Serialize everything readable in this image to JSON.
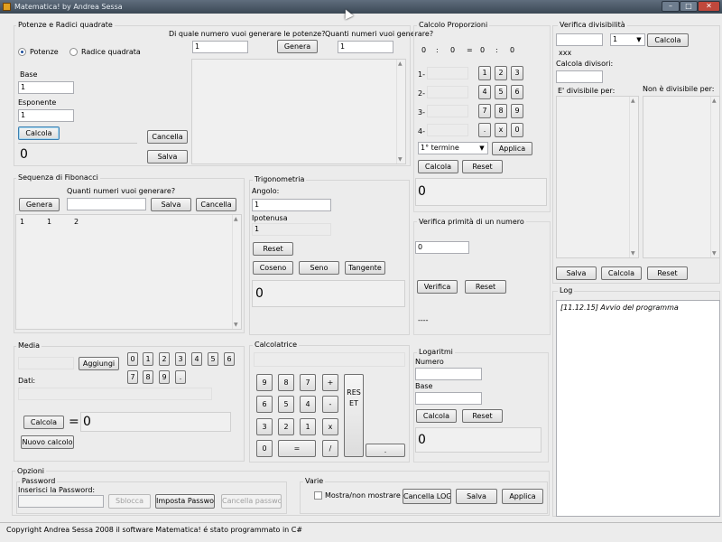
{
  "window": {
    "title": "Matematica! by Andrea Sessa",
    "minimize": "–",
    "maximize": "□",
    "close": "✕"
  },
  "potenze": {
    "title": "Potenze e Radici quadrate",
    "radio_potenze": "Potenze",
    "radio_radice": "Radice quadrata",
    "base_label": "Base",
    "base_value": "1",
    "esponente_label": "Esponente",
    "esponente_value": "1",
    "calcola": "Calcola",
    "result": "0",
    "cancella": "Cancella",
    "salva": "Salva",
    "from_label": "Di quale numero vuoi generare le potenze?",
    "from_value": "1",
    "genera": "Genera",
    "count_label": "Quanti numeri vuoi generare?",
    "count_value": "1"
  },
  "proporzioni": {
    "title": "Calcolo Proporzioni",
    "display": [
      "0",
      ":",
      "0",
      "=",
      "0",
      ":",
      "0"
    ],
    "rows": [
      "1-",
      "2-",
      "3-",
      "4-"
    ],
    "keypad": [
      [
        "1",
        "2",
        "3"
      ],
      [
        "4",
        "5",
        "6"
      ],
      [
        "7",
        "8",
        "9"
      ],
      [
        ".",
        "x",
        "0"
      ]
    ],
    "combo": "1° termine",
    "applica": "Applica",
    "calcola": "Calcola",
    "reset": "Reset",
    "result": "0"
  },
  "divisibilita": {
    "title": "Verifica divisibilità",
    "number_value": "",
    "combo": "1",
    "calcola": "Calcola",
    "xxx": "xxx",
    "divisori_label": "Calcola divisori:",
    "divisibile_label": "E' divisibile per:",
    "non_divisibile_label": "Non è divisibile per:",
    "salva": "Salva",
    "calcola2": "Calcola",
    "reset": "Reset"
  },
  "fibonacci": {
    "title": "Sequenza di Fibonacci",
    "count_label": "Quanti numeri vuoi generare?",
    "genera": "Genera",
    "salva": "Salva",
    "cancella": "Cancella",
    "values": [
      "1",
      "1",
      "2"
    ]
  },
  "trigonometria": {
    "title": "Trigonometria",
    "angolo_label": "Angolo:",
    "angolo_value": "1",
    "ipotenusa_label": "Ipotenusa",
    "ipotenusa_value": "1",
    "reset": "Reset",
    "coseno": "Coseno",
    "seno": "Seno",
    "tangente": "Tangente",
    "result": "0"
  },
  "primo": {
    "title": "Verifica primità di un numero",
    "value": "0",
    "verifica": "Verifica",
    "reset": "Reset",
    "result": "----"
  },
  "log": {
    "title": "Log",
    "entries": [
      "[11.12.15] Avvio del programma"
    ]
  },
  "media": {
    "title": "Media",
    "aggiungi": "Aggiungi",
    "keypad_row1": [
      "0",
      "1",
      "2",
      "3",
      "4",
      "5",
      "6"
    ],
    "keypad_row2": [
      "7",
      "8",
      "9",
      "."
    ],
    "dati_label": "Dati:",
    "calcola": "Calcola",
    "equals": "=",
    "result": "0",
    "nuovo": "Nuovo calcolo"
  },
  "calcolatrice": {
    "title": "Calcolatrice",
    "keys": [
      [
        "9",
        "8",
        "7",
        "+"
      ],
      [
        "6",
        "5",
        "4",
        "-"
      ],
      [
        "3",
        "2",
        "1",
        "x"
      ]
    ],
    "zero": "0",
    "equals": "=",
    "divide": "/",
    "reset": "RESET",
    "dot": "."
  },
  "logaritmi": {
    "title": "Logaritmi",
    "numero_label": "Numero",
    "base_label": "Base",
    "calcola": "Calcola",
    "reset": "Reset",
    "result": "0"
  },
  "opzioni": {
    "title": "Opzioni",
    "password_title": "Password",
    "password_label": "Inserisci la Password:",
    "sblocca": "Sblocca",
    "imposta": "Imposta Password",
    "cancella_password": "Cancella password",
    "varie_title": "Varie",
    "mostra": "Mostra/non mostrare ora",
    "cancella_log": "Cancella LOG",
    "salva": "Salva",
    "applica": "Applica"
  },
  "status": {
    "text": "Copyright Andrea Sessa 2008 il software Matematica! é stato programmato in C#"
  }
}
